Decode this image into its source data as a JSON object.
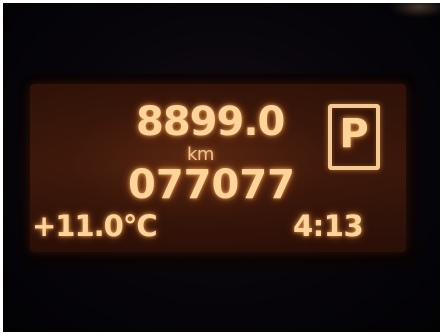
{
  "display": {
    "trip_distance": "8899.0",
    "distance_unit": "km",
    "odometer": "077077",
    "outside_temperature": "+11.0°C",
    "clock": "4:13",
    "gear_indicator": "P"
  },
  "colors": {
    "lcd_text": "#ffd49a",
    "lcd_background": "#3a170a",
    "surroundings": "#07050a"
  }
}
